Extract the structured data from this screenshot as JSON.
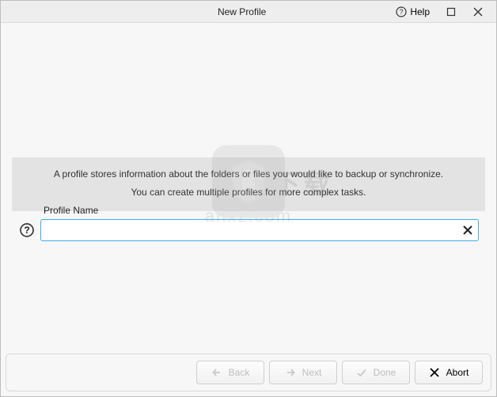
{
  "window": {
    "title": "New Profile",
    "help_label": "Help"
  },
  "info": {
    "line1": "A profile stores information about the folders or files you would like to backup or synchronize.",
    "line2": "You can create multiple profiles for more complex tasks."
  },
  "form": {
    "profile_name_label": "Profile Name",
    "profile_name_value": "",
    "profile_name_placeholder": ""
  },
  "buttons": {
    "back": "Back",
    "next": "Next",
    "done": "Done",
    "abort": "Abort"
  },
  "watermark": {
    "cn": "安下载",
    "domain": "anxz.com"
  }
}
